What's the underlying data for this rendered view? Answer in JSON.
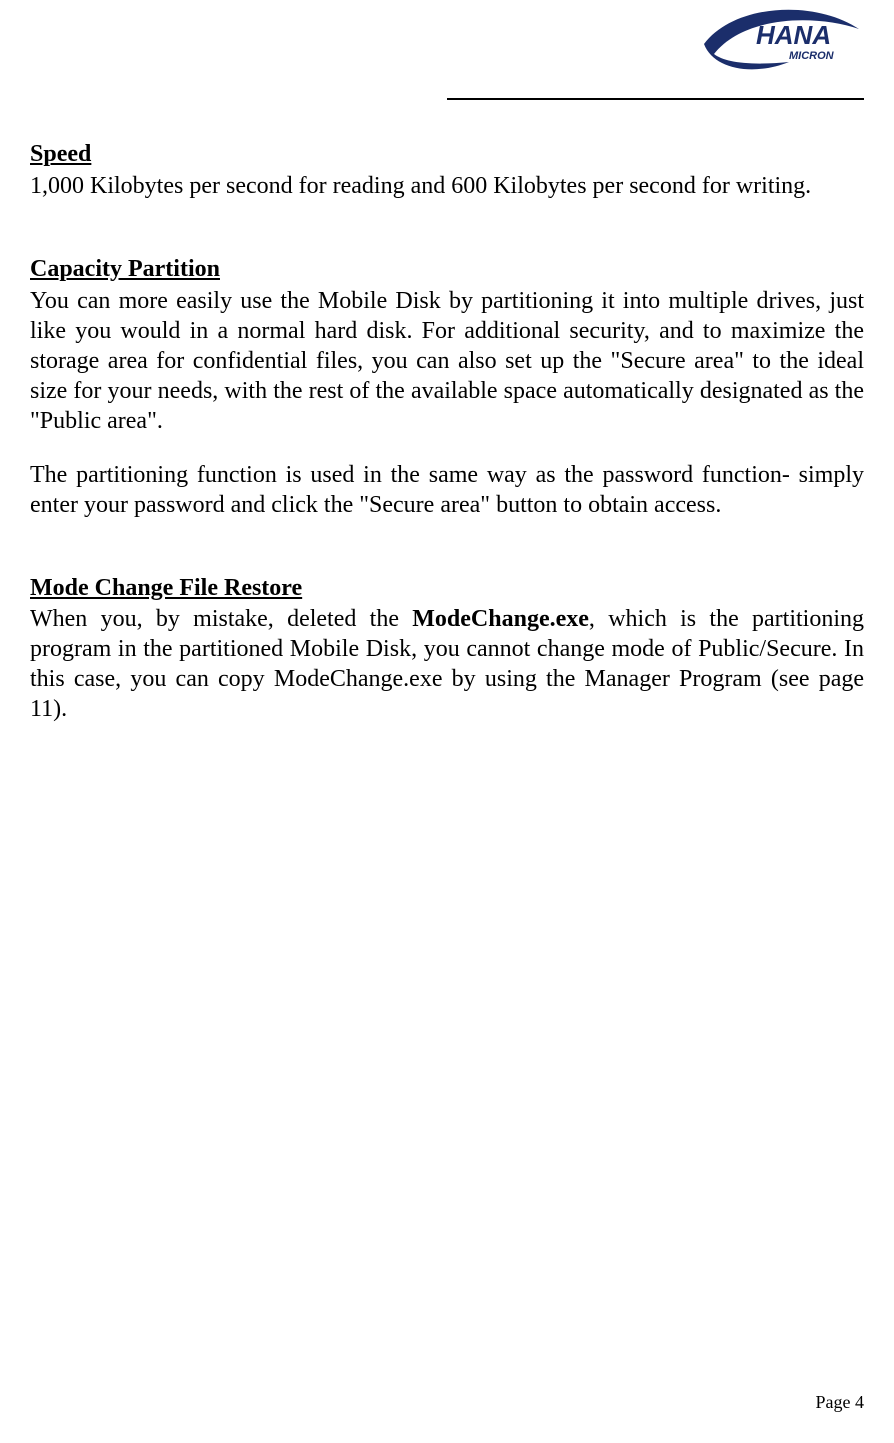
{
  "logo": {
    "brand_main": "HANA",
    "brand_sub": "MICRON"
  },
  "sections": {
    "speed": {
      "heading": "Speed",
      "p1": "1,000 Kilobytes per second for reading and 600 Kilobytes per second for writing."
    },
    "capacity": {
      "heading": "Capacity Partition",
      "p1": "You can more easily use the Mobile Disk by partitioning it into multiple drives, just like you would in a normal hard disk.  For additional security, and to maximize the storage area for confidential files, you can also set up the \"Secure area\" to the ideal size for your needs, with the rest of the available space automatically designated as the \"Public area\".",
      "p2": "The partitioning function is used in the same way as the password function- simply enter your password and click the \"Secure area\" button to obtain access."
    },
    "mode": {
      "heading": "Mode Change File Restore",
      "p1_a": "When you, by mistake, deleted the ",
      "p1_bold": "ModeChange.exe",
      "p1_b": ", which is the partitioning program in the partitioned Mobile Disk, you cannot change mode of Public/Secure.  In this case, you can copy ModeChange.exe by using the Manager Program (see page 11)."
    }
  },
  "footer": {
    "page_label": "Page 4"
  }
}
